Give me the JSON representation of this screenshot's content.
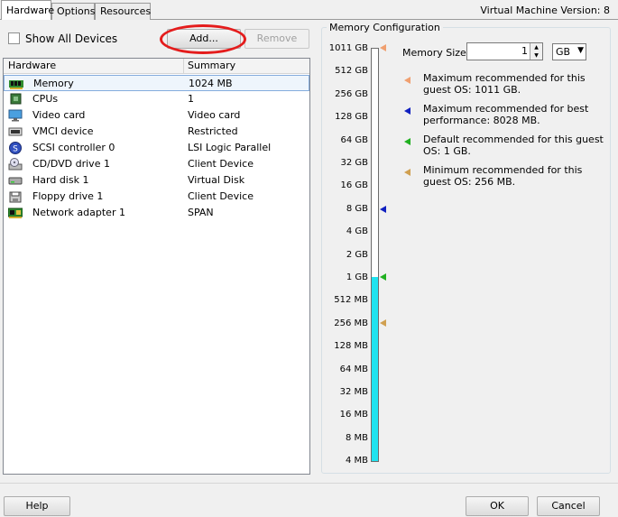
{
  "tabs": [
    {
      "label": "Hardware",
      "active": true
    },
    {
      "label": "Options",
      "active": false
    },
    {
      "label": "Resources",
      "active": false
    }
  ],
  "vm_version": "Virtual Machine Version: 8",
  "show_all_devices": {
    "label": "Show All Devices",
    "checked": false
  },
  "buttons": {
    "add": "Add...",
    "remove": "Remove",
    "help": "Help",
    "ok": "OK",
    "cancel": "Cancel"
  },
  "hardware_table": {
    "columns": [
      "Hardware",
      "Summary"
    ],
    "rows": [
      {
        "icon": "memory-icon",
        "name": "Memory",
        "summary": "1024 MB",
        "selected": true
      },
      {
        "icon": "cpu-icon",
        "name": "CPUs",
        "summary": "1",
        "selected": false
      },
      {
        "icon": "video-card-icon",
        "name": "Video card",
        "summary": "Video card",
        "selected": false
      },
      {
        "icon": "vmci-device-icon",
        "name": "VMCI device",
        "summary": "Restricted",
        "selected": false
      },
      {
        "icon": "scsi-controller-icon",
        "name": "SCSI controller 0",
        "summary": "LSI Logic Parallel",
        "selected": false
      },
      {
        "icon": "cd-dvd-drive-icon",
        "name": "CD/DVD drive 1",
        "summary": "Client Device",
        "selected": false
      },
      {
        "icon": "hard-disk-icon",
        "name": "Hard disk 1",
        "summary": "Virtual Disk",
        "selected": false
      },
      {
        "icon": "floppy-drive-icon",
        "name": "Floppy drive 1",
        "summary": "Client Device",
        "selected": false
      },
      {
        "icon": "network-adapter-icon",
        "name": "Network adapter 1",
        "summary": "SPAN",
        "selected": false
      }
    ]
  },
  "memory_config": {
    "title": "Memory Configuration",
    "memory_size_label": "Memory Size:",
    "memory_size_value": "1",
    "unit": "GB",
    "scale_labels": [
      "1011 GB",
      "512 GB",
      "256 GB",
      "128 GB",
      "64 GB",
      "32 GB",
      "16 GB",
      "8 GB",
      "4 GB",
      "2 GB",
      "1 GB",
      "512 MB",
      "256 MB",
      "128 MB",
      "64 MB",
      "32 MB",
      "16 MB",
      "8 MB",
      "4 MB"
    ],
    "legend": [
      {
        "color": "#f0a070",
        "text": "Maximum recommended for this guest OS: 1011 GB."
      },
      {
        "color": "#1020c0",
        "text": "Maximum recommended for best performance: 8028 MB."
      },
      {
        "color": "#20b020",
        "text": "Default recommended for this guest OS: 1 GB."
      },
      {
        "color": "#d0a050",
        "text": "Minimum recommended for this guest OS: 256 MB."
      }
    ],
    "colors": {
      "fill": "#1fe3f0"
    }
  }
}
